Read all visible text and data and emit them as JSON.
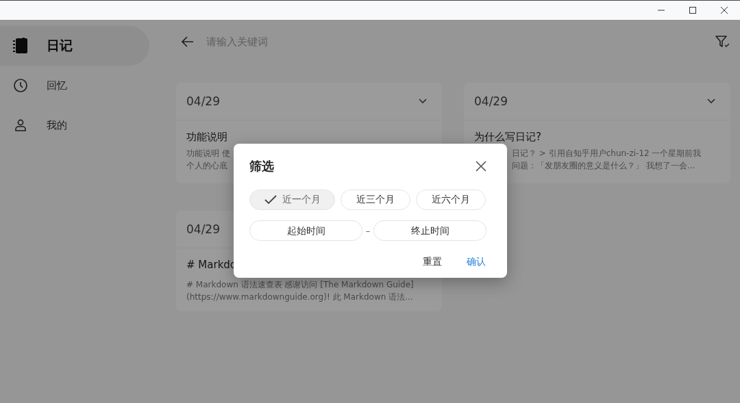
{
  "sidebar": {
    "items": [
      {
        "label": "日记",
        "selected": true
      },
      {
        "label": "回忆",
        "selected": false
      },
      {
        "label": "我的",
        "selected": false
      }
    ]
  },
  "search": {
    "placeholder": "请输入关键词"
  },
  "cards": [
    {
      "date": "04/29",
      "title": "功能说明",
      "excerpt": [
        "功能说明 使",
        "个人的心底"
      ]
    },
    {
      "date": "04/29",
      "title": "为什么写日记?",
      "excerpt": [
        "日记？ > 引用自知乎用户chun-zi-12 一个星期前我",
        "问题：「发朋友圈的意义是什么？」 我想了一会..."
      ]
    },
    {
      "date": "04/29",
      "title": "# Markdo",
      "excerpt": [
        "# Markdown 语法速查表 感谢访问 [The Markdown Guide]",
        "(https://www.markdownguide.org)! 此 Markdown 语法..."
      ]
    }
  ],
  "filter_dialog": {
    "title": "筛选",
    "presets": [
      {
        "label": "近一个月",
        "selected": true
      },
      {
        "label": "近三个月",
        "selected": false
      },
      {
        "label": "近六个月",
        "selected": false
      }
    ],
    "start_placeholder": "起始时间",
    "separator": "–",
    "end_placeholder": "终止时间",
    "buttons": [
      {
        "label": "重置",
        "kind": "plain"
      },
      {
        "label": "确认",
        "kind": "primary"
      }
    ]
  }
}
